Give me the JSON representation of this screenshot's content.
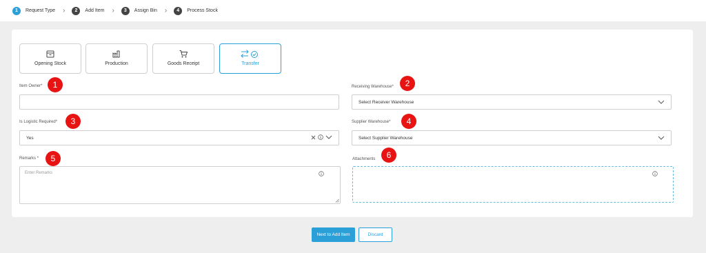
{
  "stepper": {
    "steps": [
      {
        "number": "1",
        "label": "Request Type",
        "active": true
      },
      {
        "number": "2",
        "label": "Add Item",
        "active": false
      },
      {
        "number": "3",
        "label": "Assign Bin",
        "active": false
      },
      {
        "number": "4",
        "label": "Process Stock",
        "active": false
      }
    ],
    "separator": "›"
  },
  "request_types": [
    {
      "label": "Opening Stock",
      "icon": "box-icon"
    },
    {
      "label": "Production",
      "icon": "factory-icon"
    },
    {
      "label": "Goods Receipt",
      "icon": "cart-icon"
    },
    {
      "label": "Transfer",
      "icon": "transfer-icon",
      "selected": true
    }
  ],
  "form": {
    "item_owner": {
      "label": "Item Owner",
      "value": ""
    },
    "receiving_warehouse": {
      "label": "Receiving Warehouse",
      "value": "Select Receiver Warehouse"
    },
    "is_logistic_required": {
      "label": "Is Logistic Required",
      "value": "Yes"
    },
    "supplier_warehouse": {
      "label": "Supplier Warehouse",
      "value": "Select Supplier Warehouse"
    },
    "remarks": {
      "label": "Remarks",
      "placeholder": "Enter Remarks"
    },
    "attachments": {
      "label": "Attachments"
    },
    "required_marker": "*"
  },
  "annotations": [
    "1",
    "2",
    "3",
    "4",
    "5",
    "6"
  ],
  "buttons": {
    "next": "Next to Add Item",
    "discard": "Discard"
  },
  "colors": {
    "accent": "#2a9fd8",
    "badge": "#e81414"
  }
}
